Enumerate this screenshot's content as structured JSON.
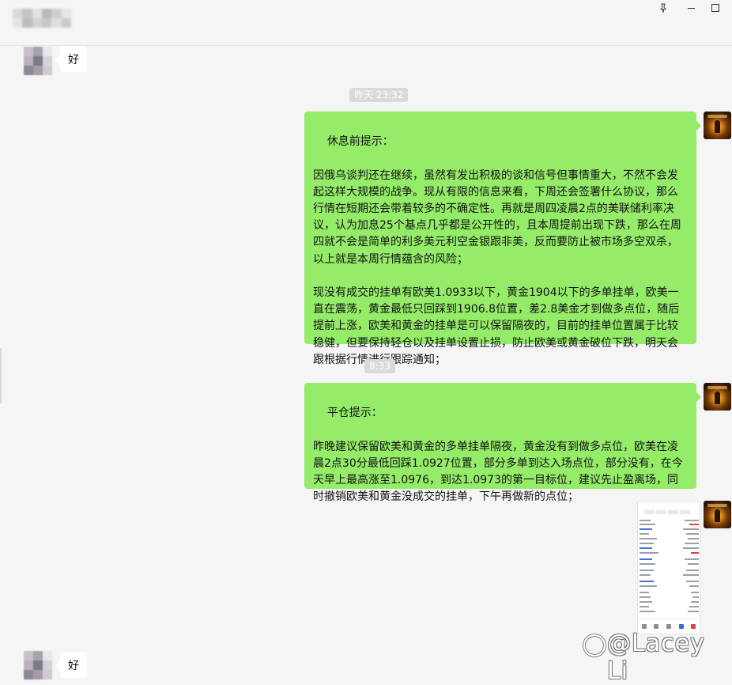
{
  "titlebar": {
    "pin_icon": "pin-icon",
    "minimize_icon": "minimize-icon",
    "maximize_icon": "maximize-icon"
  },
  "messages": {
    "first_reply": "好",
    "time_1": "昨天 23:32",
    "msg_1": "休息前提示：\n\n因俄乌谈判还在继续，虽然有发出积极的谈和信号但事情重大，不然不会发起这样大规模的战争。现从有限的信息来看，下周还会签署什么协议，那么行情在短期还会带着较多的不确定性。再就是周四凌晨2点的美联储利率决议，认为加息25个基点几乎都是公开性的，且本周提前出现下跌，那么在周四就不会是简单的利多美元利空金银跟非美，反而要防止被市场多空双杀，以上就是本周行情蕴含的风险；\n\n现没有成交的挂单有欧美1.0933以下，黄金1904以下的多单挂单，欧美一直在震荡，黄金最低只回踩到1906.8位置，差2.8美金才到做多点位，随后提前上涨，欧美和黄金的挂单是可以保留隔夜的，目前的挂单位置属于比较稳健，但要保持轻仓以及挂单设置止损，防止欧美或黄金破位下跌，明天会跟根据行情进行跟踪通知；",
    "time_2": "8:33",
    "msg_2": "平仓提示：\n\n昨晚建议保留欧美和黄金的多单挂单隔夜，黄金没有到做多点位，欧美在凌晨2点30分最低回踩1.0927位置，部分多单到达入场点位，部分没有，在今天早上最高涨至1.0976，到达1.0973的第一目标位，建议先止盈离场，同时撤销欧美和黄金没成交的挂单，下午再做新的点位；",
    "last_reply": "好"
  },
  "watermark": {
    "text": "@Lacey Li"
  },
  "colors": {
    "bubble_green": "#95ec69",
    "bubble_white": "#ffffff",
    "background": "#f5f5f5",
    "time_badge": "#dadada"
  }
}
